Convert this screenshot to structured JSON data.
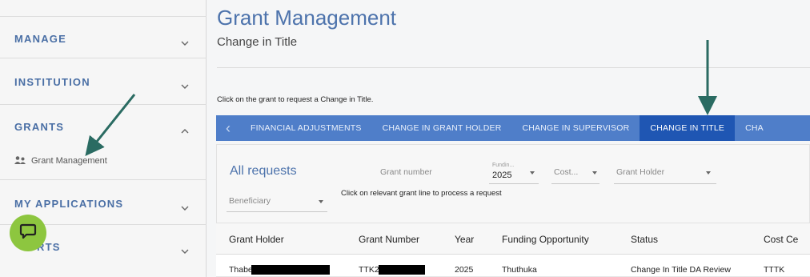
{
  "sidebar": {
    "sections": [
      {
        "label": "MANAGE",
        "expanded": false
      },
      {
        "label": "INSTITUTION",
        "expanded": false
      },
      {
        "label": "GRANTS",
        "expanded": true
      },
      {
        "label": "MY APPLICATIONS",
        "expanded": false
      },
      {
        "label": "RTS",
        "expanded": false
      }
    ],
    "grants_sub_item": {
      "label": "Grant Management",
      "icon": "users-icon"
    }
  },
  "chat": {
    "icon": "chat-icon"
  },
  "header": {
    "title": "Grant Management",
    "subtitle": "Change in Title"
  },
  "instruction": "Click on the grant to request a Change in Title.",
  "tabs": {
    "prev_icon": "chevron-left-icon",
    "items": [
      {
        "label": "FINANCIAL ADJUSTMENTS",
        "active": false
      },
      {
        "label": "CHANGE IN GRANT HOLDER",
        "active": false
      },
      {
        "label": "CHANGE IN SUPERVISOR",
        "active": false
      },
      {
        "label": "CHANGE IN TITLE",
        "active": true
      },
      {
        "label": "CHA",
        "active": false
      }
    ]
  },
  "requests": {
    "title": "All requests",
    "filters": {
      "grant_number_placeholder": "Grant number",
      "funding_label": "Fundin...",
      "funding_value": "2025",
      "cost_placeholder": "Cost...",
      "grant_holder_placeholder": "Grant Holder",
      "beneficiary_placeholder": "Beneficiary"
    },
    "process_instruction": "Click on relevant grant line to process a request",
    "columns": [
      "Grant Holder",
      "Grant Number",
      "Year",
      "Funding Opportunity",
      "Status",
      "Cost Ce"
    ],
    "rows": [
      {
        "grant_holder": "Thabe",
        "grant_number": "TTK2",
        "year": "2025",
        "funding_opportunity": "Thuthuka",
        "status": "Change In Title DA Review",
        "cost_centre": "TTTK"
      }
    ]
  },
  "colors": {
    "accent": "#4f7ec9",
    "active_tab": "#1f56b3",
    "title_blue": "#4d73ac",
    "chat_green": "#8dc63f",
    "annotation_arrow": "#2a6b62"
  }
}
